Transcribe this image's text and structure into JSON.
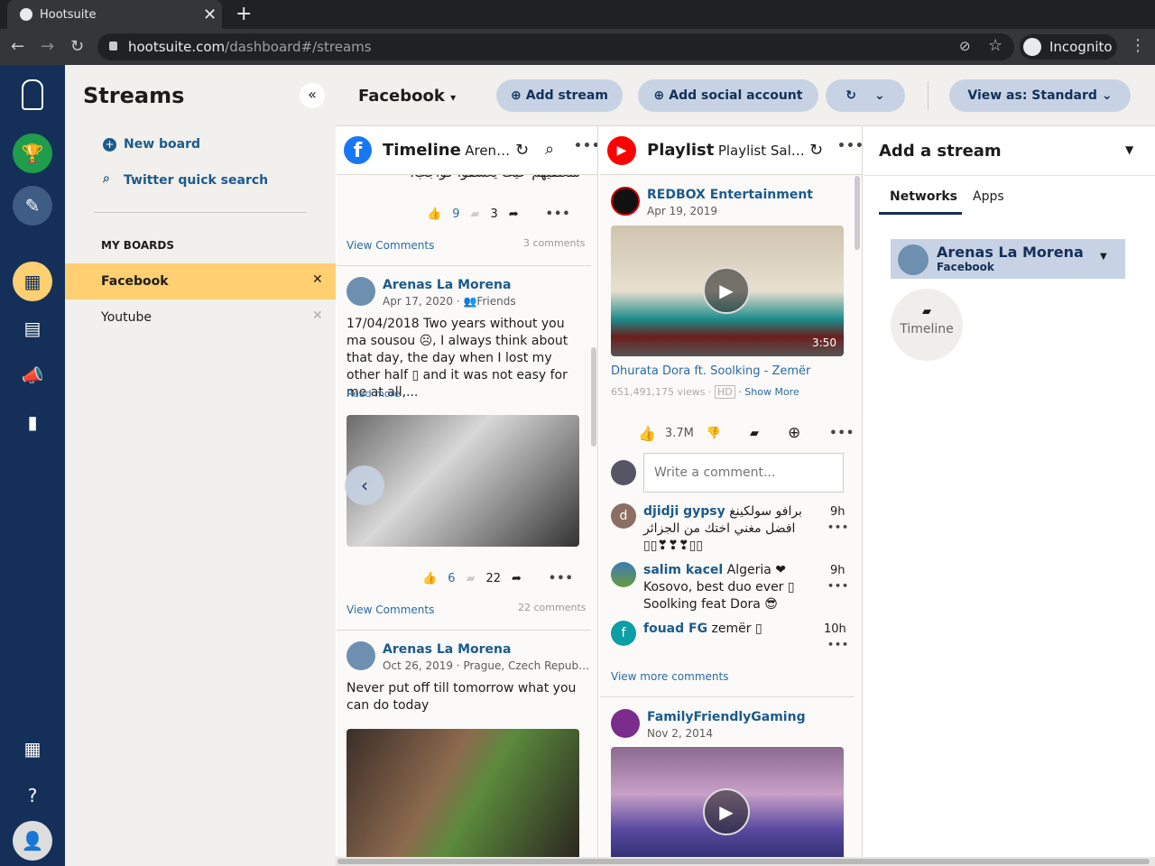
{
  "browser": {
    "tab_title": "Hootsuite",
    "url_host": "hootsuite.com",
    "url_path": "/dashboard#/streams",
    "incognito": "Incognito"
  },
  "sidebar": {
    "title": "Streams",
    "new_board": "New board",
    "twitter_search": "Twitter quick search",
    "my_boards": "MY BOARDS",
    "boards": [
      {
        "label": "Facebook"
      },
      {
        "label": "Youtube"
      }
    ]
  },
  "toolbar": {
    "board": "Facebook",
    "add_stream": "Add stream",
    "add_social": "Add social account",
    "view_as": "View as: Standard"
  },
  "col1": {
    "title": "Timeline",
    "subtitle": "Aren…",
    "post0": {
      "arabic": "متعلقيهم حيث يعشقوا كواجب.",
      "likes": "9",
      "comments": "3",
      "view_comments": "View Comments",
      "comments_count": "3 comments"
    },
    "post1": {
      "author": "Arenas La Morena",
      "date": "Apr 17, 2020 ·",
      "audience": "Friends",
      "text": "17/04/2018 Two years without you ma sousou ☹, I always think about that day, the day when I lost my other half ▯ and it was not easy for me at all,...",
      "read_more": "Read more",
      "likes": "6",
      "comments": "22",
      "view_comments": "View Comments",
      "comments_count": "22 comments"
    },
    "post2": {
      "author": "Arenas La Morena",
      "meta": "Oct 26, 2019 · Prague, Czech Repub…",
      "text": "Never put off till tomorrow what you can do today"
    }
  },
  "col2": {
    "title": "Playlist",
    "subtitle": "Playlist Sal…",
    "video1": {
      "channel": "REDBOX Entertainment",
      "date": "Apr 19, 2019",
      "duration": "3:50",
      "title": "Dhurata Dora ft. Soolking - Zemër",
      "views": "651,491,175 views ·",
      "hd": "HD",
      "show_more": "· Show More",
      "likes": "3.7M",
      "comment_placeholder": "Write a comment...",
      "comments": [
        {
          "author": "djidji gypsy",
          "text": "برافو سولكينغ افضل مغني اختك من الجزائر ▯▯❣❣❣▯▯",
          "time": "9h",
          "initial": "d"
        },
        {
          "author": "salim kacel",
          "text": "Algeria ❤ Kosovo, best duo ever ▯ Soolking feat Dora 😎",
          "time": "9h",
          "initial": ""
        },
        {
          "author": "fouad FG",
          "text": "zemër ▯",
          "time": "10h",
          "initial": "f"
        }
      ],
      "view_more": "View more comments"
    },
    "video2": {
      "channel": "FamilyFriendlyGaming",
      "date": "Nov 2, 2014"
    }
  },
  "add_stream": {
    "title": "Add a stream",
    "tabs": [
      "Networks",
      "Apps"
    ],
    "account": "Arenas La Morena",
    "network": "Facebook",
    "stream_type": "Timeline"
  },
  "colors": {
    "nav": "#143059",
    "accent": "#1c5a8c",
    "active_board": "#ffcf71"
  }
}
